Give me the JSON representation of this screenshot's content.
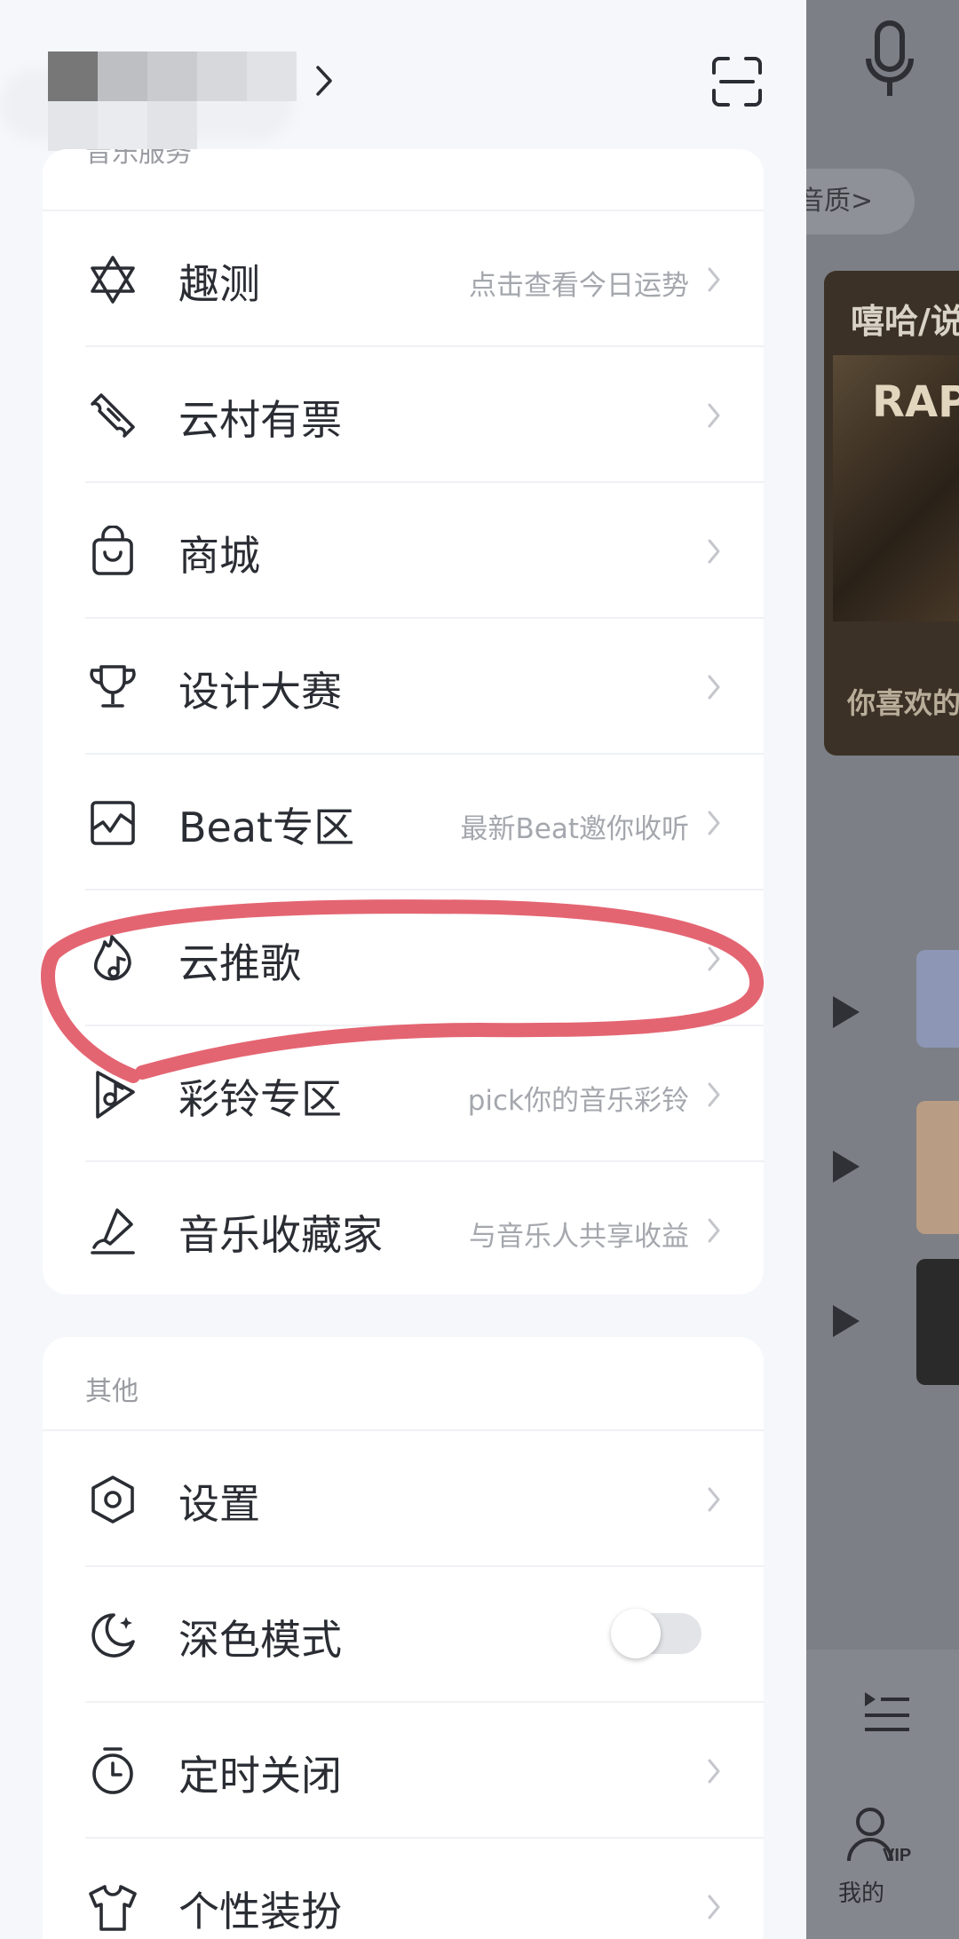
{
  "background_app": {
    "quality_label": "音质>",
    "banner_title": "嘻哈/说",
    "banner_art_text": "RAP",
    "banner_subtitle": "你喜欢的",
    "tab_mine": "我的",
    "colors": {
      "overlay": "#7c7f85"
    }
  },
  "drawer": {
    "music_services": {
      "section_title": "音乐服务",
      "items": [
        {
          "icon": "star-of-david-icon",
          "label": "趣测",
          "hint": "点击查看今日运势"
        },
        {
          "icon": "ticket-icon",
          "label": "云村有票",
          "hint": ""
        },
        {
          "icon": "shopping-bag-icon",
          "label": "商城",
          "hint": ""
        },
        {
          "icon": "trophy-icon",
          "label": "设计大赛",
          "hint": ""
        },
        {
          "icon": "beat-wave-icon",
          "label": "Beat专区",
          "hint": "最新Beat邀你收听"
        },
        {
          "icon": "flame-note-icon",
          "label": "云推歌",
          "hint": ""
        },
        {
          "icon": "ringtone-icon",
          "label": "彩铃专区",
          "hint": "pick你的音乐彩铃"
        },
        {
          "icon": "collector-icon",
          "label": "音乐收藏家",
          "hint": "与音乐人共享收益"
        }
      ]
    },
    "other": {
      "section_title": "其他",
      "items": [
        {
          "icon": "settings-hexagon-icon",
          "label": "设置"
        },
        {
          "icon": "moon-icon",
          "label": "深色模式",
          "toggle": false
        },
        {
          "icon": "timer-icon",
          "label": "定时关闭"
        },
        {
          "icon": "tshirt-icon",
          "label": "个性装扮"
        }
      ]
    },
    "colors": {
      "accent_annotation": "#e0505f",
      "text": "#2a2d33",
      "hint": "#a4a7ad"
    }
  }
}
